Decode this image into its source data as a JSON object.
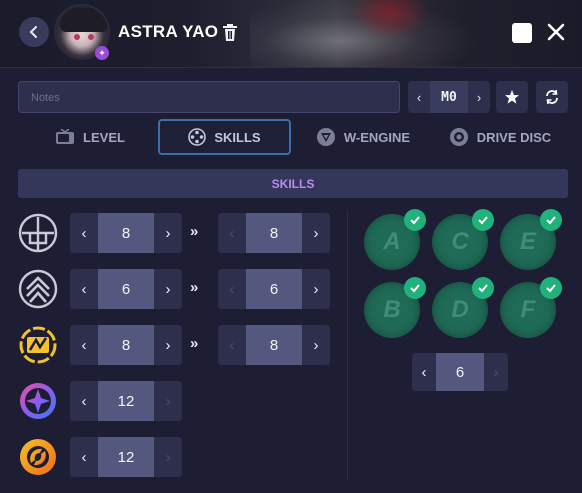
{
  "header": {
    "character_name": "ASTRA YAO",
    "back_icon": "chevron-left-icon",
    "delete_icon": "trash-icon",
    "close_icon": "close-icon"
  },
  "toolbar": {
    "notes_placeholder": "Notes",
    "mindscape": {
      "value": "M0",
      "prev": "‹",
      "next": "›"
    },
    "favorite_icon": "star-icon",
    "reset_icon": "refresh-icon"
  },
  "tabs": [
    {
      "label": "LEVEL",
      "icon": "tv-icon",
      "active": false
    },
    {
      "label": "SKILLS",
      "icon": "film-reel-icon",
      "active": true
    },
    {
      "label": "W-ENGINE",
      "icon": "w-engine-icon",
      "active": false
    },
    {
      "label": "DRIVE DISC",
      "icon": "disc-icon",
      "active": false
    }
  ],
  "skills": {
    "title": "SKILLS",
    "arrow_left": "‹",
    "arrow_right": "›",
    "double_chevron": "»",
    "rows": [
      {
        "icon": "basic-attack-icon",
        "current": "8",
        "target": "8"
      },
      {
        "icon": "dodge-icon",
        "current": "6",
        "target": "6"
      },
      {
        "icon": "assist-icon",
        "current": "8",
        "target": "8"
      },
      {
        "icon": "special-attack-icon",
        "current": "12"
      },
      {
        "icon": "chain-attack-icon",
        "current": "12"
      }
    ],
    "core": {
      "badges": [
        "A",
        "C",
        "E",
        "B",
        "D",
        "F"
      ],
      "value": "6",
      "colors": {
        "badge": "#1f6b57",
        "check": "#21b27b"
      }
    }
  },
  "colors": {
    "accent_purple": "#b88cf2",
    "active_tab_border": "#3b6fa8",
    "background": "#1d1e33"
  }
}
